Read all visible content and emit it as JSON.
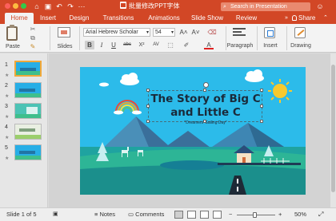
{
  "window": {
    "title": "批量修改PPT字体",
    "search_placeholder": "Search in Presentation"
  },
  "toolbar_icons": [
    "home-icon",
    "save-icon",
    "undo-icon",
    "redo-icon",
    "more-icon"
  ],
  "tabs": [
    "Home",
    "Insert",
    "Design",
    "Transitions",
    "Animations",
    "Slide Show",
    "Review"
  ],
  "active_tab": "Home",
  "share_label": "Share",
  "ribbon": {
    "paste_label": "Paste",
    "slides_label": "Slides",
    "font_name": "Arial Hebrew Scholar",
    "font_size": "54",
    "grow_font": "A˄",
    "shrink_font": "A˅",
    "bold": "B",
    "italic": "I",
    "underline": "U",
    "strike": "abc",
    "superscript": "X²",
    "char_spacing": "AV",
    "font_color": "A",
    "paragraph_label": "Paragraph",
    "insert_label": "Insert",
    "drawing_label": "Drawing"
  },
  "thumbnails": [
    {
      "num": "1",
      "selected": true
    },
    {
      "num": "2",
      "selected": false
    },
    {
      "num": "3",
      "selected": false
    },
    {
      "num": "4",
      "selected": false
    },
    {
      "num": "5",
      "selected": false
    }
  ],
  "slide": {
    "title_line1": "The Story of Big C",
    "title_line2": "and Little C",
    "subtitle": "“Dreamers' Sailing Day”"
  },
  "status": {
    "slide_info": "Slide 1 of 5",
    "notes_label": "Notes",
    "comments_label": "Comments",
    "zoom_minus": "−",
    "zoom_plus": "+",
    "zoom_value": "50%"
  },
  "colors": {
    "accent": "#d24726",
    "slide_bg": "#2cbbea"
  }
}
